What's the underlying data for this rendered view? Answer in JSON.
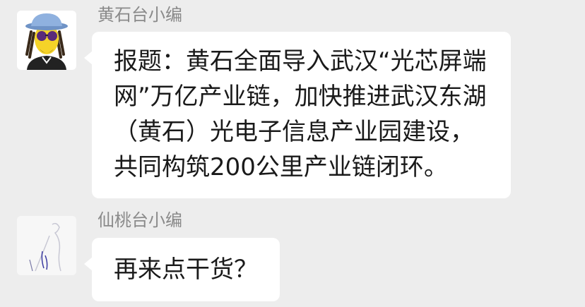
{
  "messages": [
    {
      "sender": "黄石台小编",
      "lines": [
        "报题：黄石全面导入武汉“光芯屏端",
        "网”万亿产业链，加快推进武汉东湖",
        "（黄石）光电子信息产业园建设，",
        "共同构筑200公里产业链闭环。"
      ]
    },
    {
      "sender": "仙桃台小编",
      "lines": [
        "再来点干货？"
      ]
    }
  ],
  "colors": {
    "background": "#ededed",
    "bubble": "#ffffff",
    "sender_text": "#8a8a8a",
    "message_text": "#1a1a1a"
  },
  "icons": {
    "avatar_1": "cartoon-character-avatar",
    "avatar_2": "sketch-figure-avatar"
  }
}
